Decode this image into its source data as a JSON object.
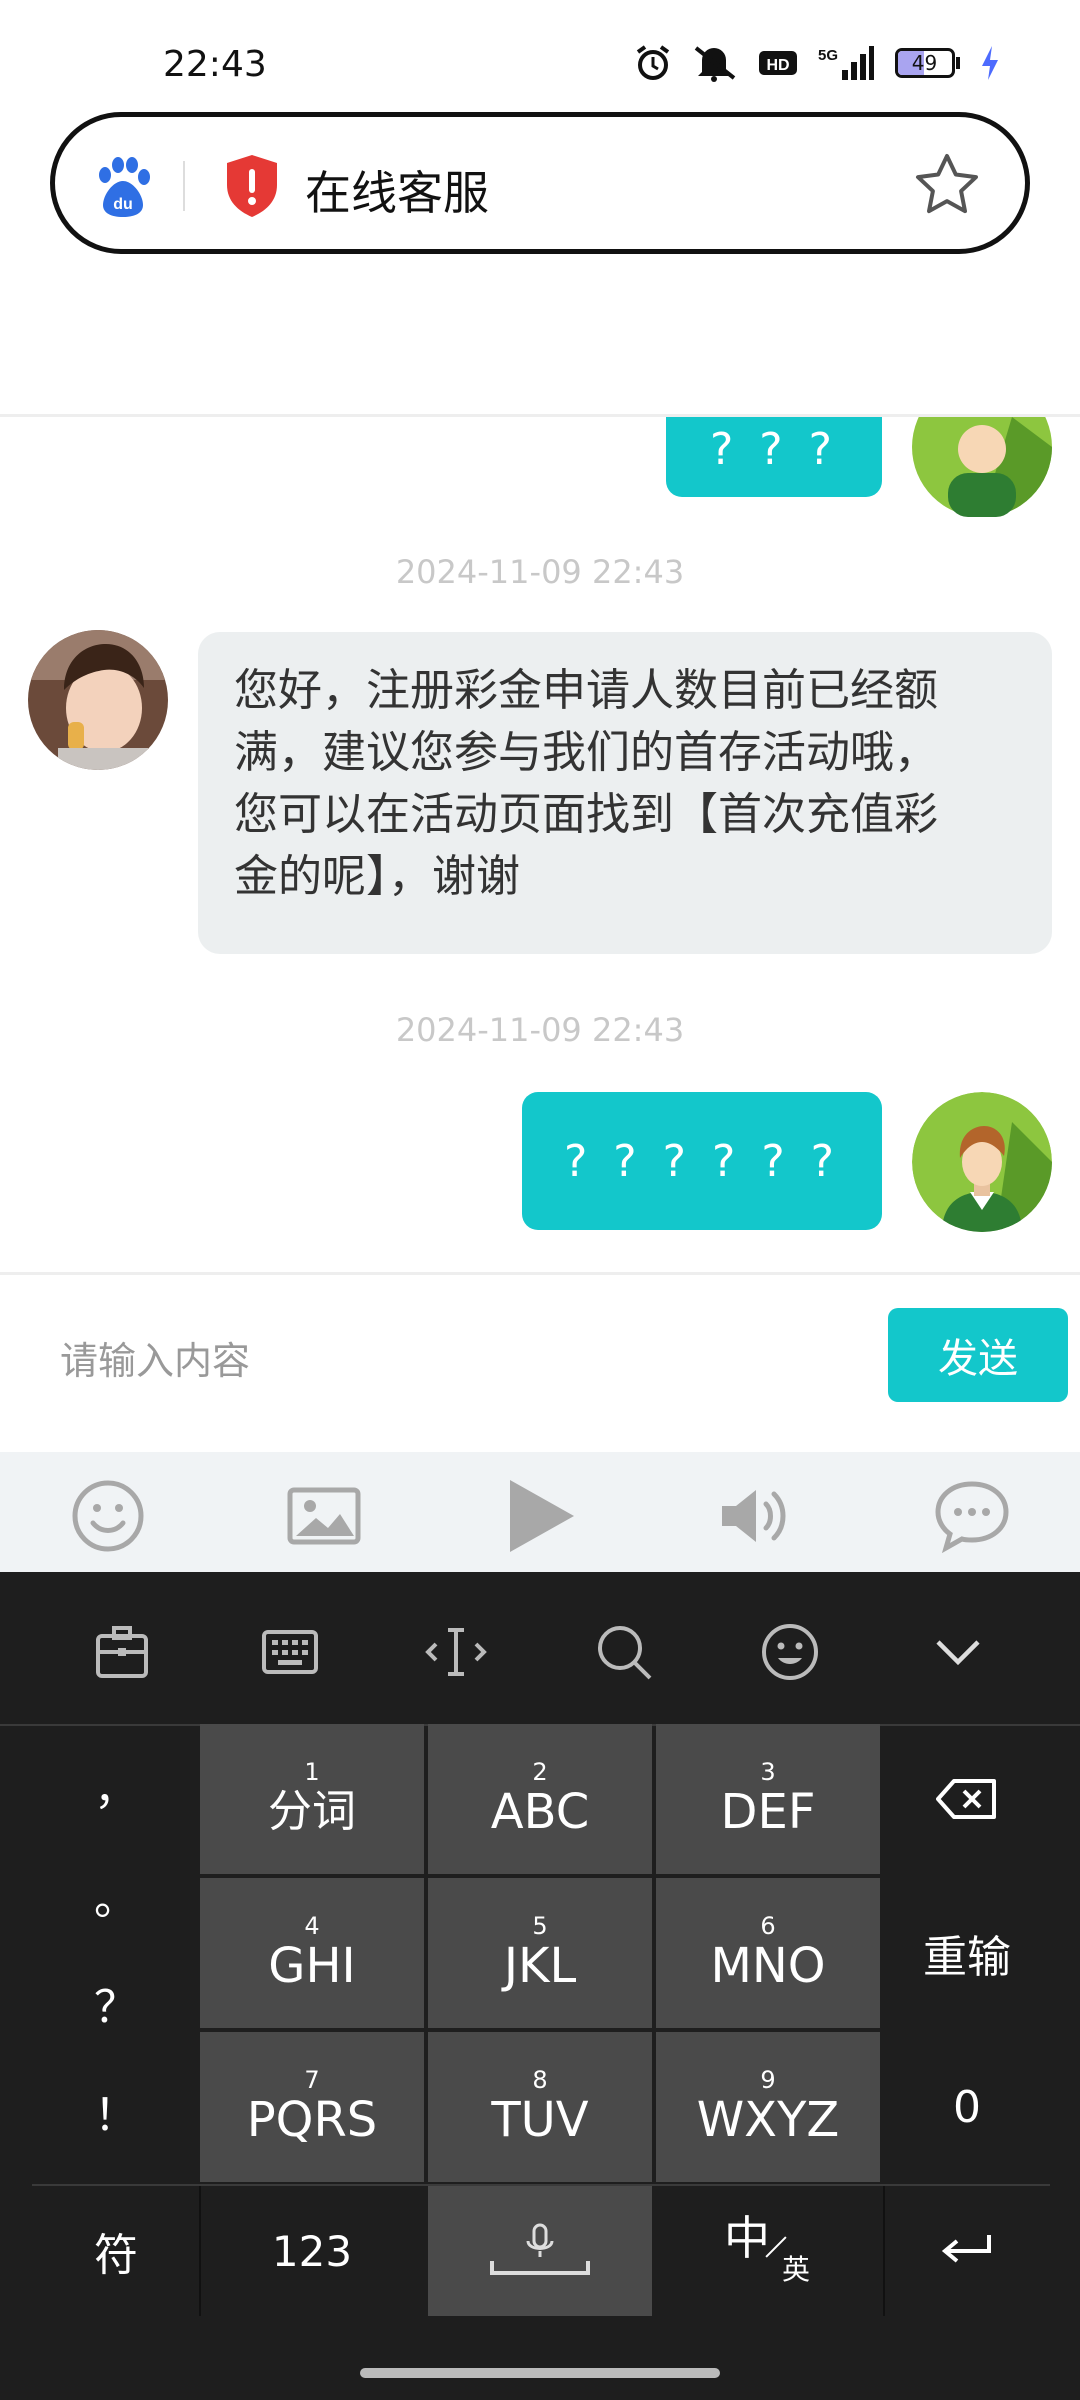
{
  "status_bar": {
    "time": "22:43",
    "battery": "49",
    "network": "5G",
    "hd": "HD1"
  },
  "address_bar": {
    "title": "在线客服"
  },
  "chat": {
    "messages": [
      {
        "side": "out",
        "text": "? ? ?"
      },
      {
        "timestamp": "2024-11-09 22:43"
      },
      {
        "side": "in",
        "text": "您好，注册彩金申请人数目前已经额满，建议您参与我们的首存活动哦，您可以在活动页面找到【首次充值彩金的呢】，谢谢"
      },
      {
        "timestamp": "2024-11-09 22:43"
      },
      {
        "side": "out",
        "text": "? ? ? ? ? ?"
      }
    ],
    "line1": "您好，注册彩金申请人数目前已经额",
    "line2": "满，建议您参与我们的首存活动哦，",
    "line3": "您可以在活动页面找到【首次充值彩",
    "line4": "金的呢】，谢谢"
  },
  "input": {
    "placeholder": "请输入内容",
    "send_label": "发送"
  },
  "toolbar": {
    "icons": [
      "emoji-icon",
      "image-icon",
      "play-icon",
      "speaker-icon",
      "chat-bubble-icon"
    ]
  },
  "keyboard": {
    "top_icons": [
      "clipboard-icon",
      "keyboard-icon",
      "cursor-icon",
      "search-icon",
      "emoji-icon",
      "collapse-icon"
    ],
    "punct": [
      "，",
      "。",
      "？",
      "！"
    ],
    "keys": [
      {
        "num": "1",
        "label": "分词"
      },
      {
        "num": "2",
        "label": "ABC"
      },
      {
        "num": "3",
        "label": "DEF"
      },
      {
        "num": "4",
        "label": "GHI"
      },
      {
        "num": "5",
        "label": "JKL"
      },
      {
        "num": "6",
        "label": "MNO"
      },
      {
        "num": "7",
        "label": "PQRS"
      },
      {
        "num": "8",
        "label": "TUV"
      },
      {
        "num": "9",
        "label": "WXYZ"
      }
    ],
    "reenter": "重输",
    "zero": "0",
    "symbols": "符",
    "numbers": "123",
    "lang_zh": "中",
    "lang_en": "英"
  }
}
